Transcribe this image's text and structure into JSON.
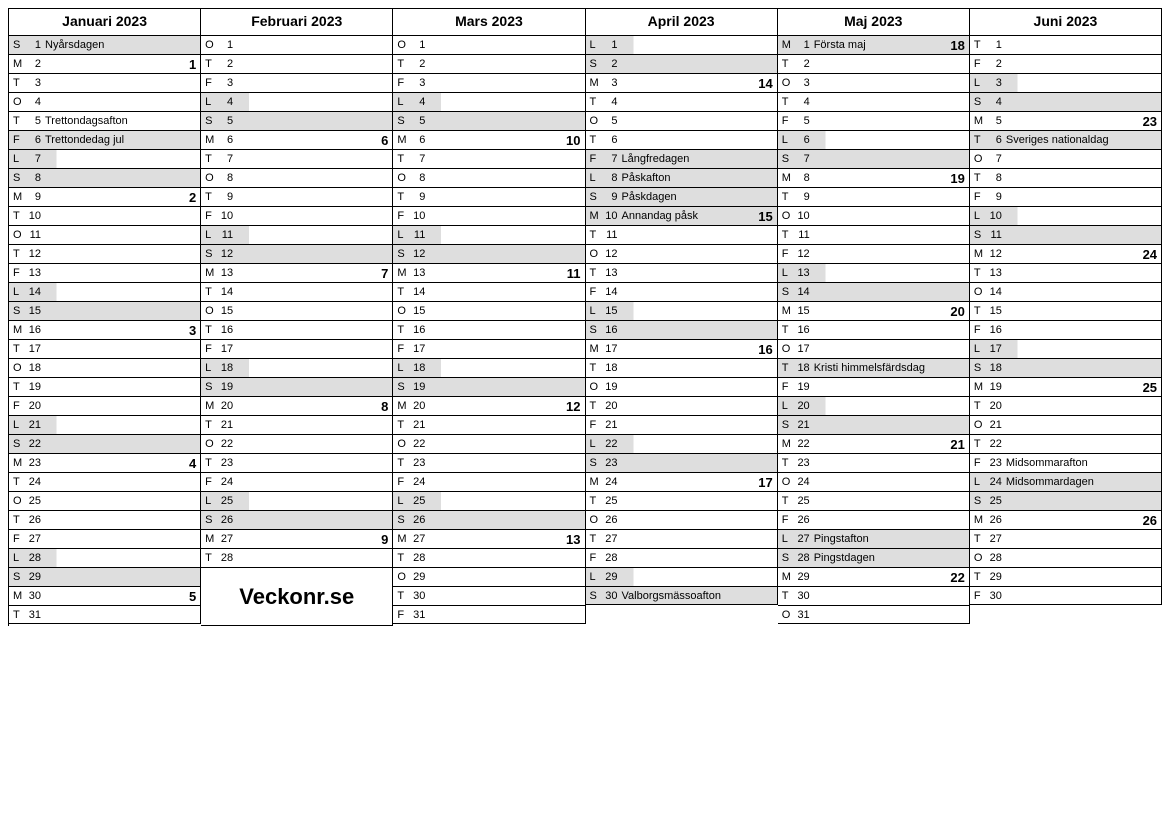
{
  "branding": "Veckonr.se",
  "months": [
    {
      "name": "Januari 2023",
      "days": [
        {
          "wd": "S",
          "n": 1,
          "label": "Nyårsdagen",
          "shade": "full"
        },
        {
          "wd": "M",
          "n": 2,
          "week": 1
        },
        {
          "wd": "T",
          "n": 3
        },
        {
          "wd": "O",
          "n": 4
        },
        {
          "wd": "T",
          "n": 5,
          "label": "Trettondagsafton"
        },
        {
          "wd": "F",
          "n": 6,
          "label": "Trettondedag jul",
          "shade": "full"
        },
        {
          "wd": "L",
          "n": 7,
          "shade": "partial"
        },
        {
          "wd": "S",
          "n": 8,
          "shade": "full"
        },
        {
          "wd": "M",
          "n": 9,
          "week": 2
        },
        {
          "wd": "T",
          "n": 10
        },
        {
          "wd": "O",
          "n": 11
        },
        {
          "wd": "T",
          "n": 12
        },
        {
          "wd": "F",
          "n": 13
        },
        {
          "wd": "L",
          "n": 14,
          "shade": "partial"
        },
        {
          "wd": "S",
          "n": 15,
          "shade": "full"
        },
        {
          "wd": "M",
          "n": 16,
          "week": 3
        },
        {
          "wd": "T",
          "n": 17
        },
        {
          "wd": "O",
          "n": 18
        },
        {
          "wd": "T",
          "n": 19
        },
        {
          "wd": "F",
          "n": 20
        },
        {
          "wd": "L",
          "n": 21,
          "shade": "partial"
        },
        {
          "wd": "S",
          "n": 22,
          "shade": "full"
        },
        {
          "wd": "M",
          "n": 23,
          "week": 4
        },
        {
          "wd": "T",
          "n": 24
        },
        {
          "wd": "O",
          "n": 25
        },
        {
          "wd": "T",
          "n": 26
        },
        {
          "wd": "F",
          "n": 27
        },
        {
          "wd": "L",
          "n": 28,
          "shade": "partial"
        },
        {
          "wd": "S",
          "n": 29,
          "shade": "full"
        },
        {
          "wd": "M",
          "n": 30,
          "week": 5
        },
        {
          "wd": "T",
          "n": 31
        }
      ]
    },
    {
      "name": "Februari 2023",
      "branding_after": true,
      "days": [
        {
          "wd": "O",
          "n": 1
        },
        {
          "wd": "T",
          "n": 2
        },
        {
          "wd": "F",
          "n": 3
        },
        {
          "wd": "L",
          "n": 4,
          "shade": "partial"
        },
        {
          "wd": "S",
          "n": 5,
          "shade": "full"
        },
        {
          "wd": "M",
          "n": 6,
          "week": 6
        },
        {
          "wd": "T",
          "n": 7
        },
        {
          "wd": "O",
          "n": 8
        },
        {
          "wd": "T",
          "n": 9
        },
        {
          "wd": "F",
          "n": 10
        },
        {
          "wd": "L",
          "n": 11,
          "shade": "partial"
        },
        {
          "wd": "S",
          "n": 12,
          "shade": "full"
        },
        {
          "wd": "M",
          "n": 13,
          "week": 7
        },
        {
          "wd": "T",
          "n": 14
        },
        {
          "wd": "O",
          "n": 15
        },
        {
          "wd": "T",
          "n": 16
        },
        {
          "wd": "F",
          "n": 17
        },
        {
          "wd": "L",
          "n": 18,
          "shade": "partial"
        },
        {
          "wd": "S",
          "n": 19,
          "shade": "full"
        },
        {
          "wd": "M",
          "n": 20,
          "week": 8
        },
        {
          "wd": "T",
          "n": 21
        },
        {
          "wd": "O",
          "n": 22
        },
        {
          "wd": "T",
          "n": 23
        },
        {
          "wd": "F",
          "n": 24
        },
        {
          "wd": "L",
          "n": 25,
          "shade": "partial"
        },
        {
          "wd": "S",
          "n": 26,
          "shade": "full"
        },
        {
          "wd": "M",
          "n": 27,
          "week": 9
        },
        {
          "wd": "T",
          "n": 28
        }
      ]
    },
    {
      "name": "Mars 2023",
      "days": [
        {
          "wd": "O",
          "n": 1
        },
        {
          "wd": "T",
          "n": 2
        },
        {
          "wd": "F",
          "n": 3
        },
        {
          "wd": "L",
          "n": 4,
          "shade": "partial"
        },
        {
          "wd": "S",
          "n": 5,
          "shade": "full"
        },
        {
          "wd": "M",
          "n": 6,
          "week": 10
        },
        {
          "wd": "T",
          "n": 7
        },
        {
          "wd": "O",
          "n": 8
        },
        {
          "wd": "T",
          "n": 9
        },
        {
          "wd": "F",
          "n": 10
        },
        {
          "wd": "L",
          "n": 11,
          "shade": "partial"
        },
        {
          "wd": "S",
          "n": 12,
          "shade": "full"
        },
        {
          "wd": "M",
          "n": 13,
          "week": 11
        },
        {
          "wd": "T",
          "n": 14
        },
        {
          "wd": "O",
          "n": 15
        },
        {
          "wd": "T",
          "n": 16
        },
        {
          "wd": "F",
          "n": 17
        },
        {
          "wd": "L",
          "n": 18,
          "shade": "partial"
        },
        {
          "wd": "S",
          "n": 19,
          "shade": "full"
        },
        {
          "wd": "M",
          "n": 20,
          "week": 12
        },
        {
          "wd": "T",
          "n": 21
        },
        {
          "wd": "O",
          "n": 22
        },
        {
          "wd": "T",
          "n": 23
        },
        {
          "wd": "F",
          "n": 24
        },
        {
          "wd": "L",
          "n": 25,
          "shade": "partial"
        },
        {
          "wd": "S",
          "n": 26,
          "shade": "full"
        },
        {
          "wd": "M",
          "n": 27,
          "week": 13
        },
        {
          "wd": "T",
          "n": 28
        },
        {
          "wd": "O",
          "n": 29
        },
        {
          "wd": "T",
          "n": 30
        },
        {
          "wd": "F",
          "n": 31
        }
      ]
    },
    {
      "name": "April 2023",
      "days": [
        {
          "wd": "L",
          "n": 1,
          "shade": "partial"
        },
        {
          "wd": "S",
          "n": 2,
          "shade": "full"
        },
        {
          "wd": "M",
          "n": 3,
          "week": 14
        },
        {
          "wd": "T",
          "n": 4
        },
        {
          "wd": "O",
          "n": 5
        },
        {
          "wd": "T",
          "n": 6
        },
        {
          "wd": "F",
          "n": 7,
          "label": "Långfredagen",
          "shade": "full"
        },
        {
          "wd": "L",
          "n": 8,
          "label": "Påskafton",
          "shade": "full"
        },
        {
          "wd": "S",
          "n": 9,
          "label": "Påskdagen",
          "shade": "full"
        },
        {
          "wd": "M",
          "n": 10,
          "label": "Annandag påsk",
          "week": 15,
          "shade": "full"
        },
        {
          "wd": "T",
          "n": 11
        },
        {
          "wd": "O",
          "n": 12
        },
        {
          "wd": "T",
          "n": 13
        },
        {
          "wd": "F",
          "n": 14
        },
        {
          "wd": "L",
          "n": 15,
          "shade": "partial"
        },
        {
          "wd": "S",
          "n": 16,
          "shade": "full"
        },
        {
          "wd": "M",
          "n": 17,
          "week": 16
        },
        {
          "wd": "T",
          "n": 18
        },
        {
          "wd": "O",
          "n": 19
        },
        {
          "wd": "T",
          "n": 20
        },
        {
          "wd": "F",
          "n": 21
        },
        {
          "wd": "L",
          "n": 22,
          "shade": "partial"
        },
        {
          "wd": "S",
          "n": 23,
          "shade": "full"
        },
        {
          "wd": "M",
          "n": 24,
          "week": 17
        },
        {
          "wd": "T",
          "n": 25
        },
        {
          "wd": "O",
          "n": 26
        },
        {
          "wd": "T",
          "n": 27
        },
        {
          "wd": "F",
          "n": 28
        },
        {
          "wd": "L",
          "n": 29,
          "shade": "partial"
        },
        {
          "wd": "S",
          "n": 30,
          "label": "Valborgsmässoafton",
          "shade": "full"
        }
      ]
    },
    {
      "name": "Maj 2023",
      "days": [
        {
          "wd": "M",
          "n": 1,
          "label": "Första maj",
          "week": 18,
          "shade": "full"
        },
        {
          "wd": "T",
          "n": 2
        },
        {
          "wd": "O",
          "n": 3
        },
        {
          "wd": "T",
          "n": 4
        },
        {
          "wd": "F",
          "n": 5
        },
        {
          "wd": "L",
          "n": 6,
          "shade": "partial"
        },
        {
          "wd": "S",
          "n": 7,
          "shade": "full"
        },
        {
          "wd": "M",
          "n": 8,
          "week": 19
        },
        {
          "wd": "T",
          "n": 9
        },
        {
          "wd": "O",
          "n": 10
        },
        {
          "wd": "T",
          "n": 11
        },
        {
          "wd": "F",
          "n": 12
        },
        {
          "wd": "L",
          "n": 13,
          "shade": "partial"
        },
        {
          "wd": "S",
          "n": 14,
          "shade": "full"
        },
        {
          "wd": "M",
          "n": 15,
          "week": 20
        },
        {
          "wd": "T",
          "n": 16
        },
        {
          "wd": "O",
          "n": 17
        },
        {
          "wd": "T",
          "n": 18,
          "label": "Kristi himmelsfärdsdag",
          "shade": "full"
        },
        {
          "wd": "F",
          "n": 19
        },
        {
          "wd": "L",
          "n": 20,
          "shade": "partial"
        },
        {
          "wd": "S",
          "n": 21,
          "shade": "full"
        },
        {
          "wd": "M",
          "n": 22,
          "week": 21
        },
        {
          "wd": "T",
          "n": 23
        },
        {
          "wd": "O",
          "n": 24
        },
        {
          "wd": "T",
          "n": 25
        },
        {
          "wd": "F",
          "n": 26
        },
        {
          "wd": "L",
          "n": 27,
          "label": "Pingstafton",
          "shade": "full"
        },
        {
          "wd": "S",
          "n": 28,
          "label": "Pingstdagen",
          "shade": "full"
        },
        {
          "wd": "M",
          "n": 29,
          "week": 22
        },
        {
          "wd": "T",
          "n": 30
        },
        {
          "wd": "O",
          "n": 31
        }
      ]
    },
    {
      "name": "Juni 2023",
      "days": [
        {
          "wd": "T",
          "n": 1
        },
        {
          "wd": "F",
          "n": 2
        },
        {
          "wd": "L",
          "n": 3,
          "shade": "partial"
        },
        {
          "wd": "S",
          "n": 4,
          "shade": "full"
        },
        {
          "wd": "M",
          "n": 5,
          "week": 23
        },
        {
          "wd": "T",
          "n": 6,
          "label": "Sveriges nationaldag",
          "shade": "full"
        },
        {
          "wd": "O",
          "n": 7
        },
        {
          "wd": "T",
          "n": 8
        },
        {
          "wd": "F",
          "n": 9
        },
        {
          "wd": "L",
          "n": 10,
          "shade": "partial"
        },
        {
          "wd": "S",
          "n": 11,
          "shade": "full"
        },
        {
          "wd": "M",
          "n": 12,
          "week": 24
        },
        {
          "wd": "T",
          "n": 13
        },
        {
          "wd": "O",
          "n": 14
        },
        {
          "wd": "T",
          "n": 15
        },
        {
          "wd": "F",
          "n": 16
        },
        {
          "wd": "L",
          "n": 17,
          "shade": "partial"
        },
        {
          "wd": "S",
          "n": 18,
          "shade": "full"
        },
        {
          "wd": "M",
          "n": 19,
          "week": 25
        },
        {
          "wd": "T",
          "n": 20
        },
        {
          "wd": "O",
          "n": 21
        },
        {
          "wd": "T",
          "n": 22
        },
        {
          "wd": "F",
          "n": 23,
          "label": "Midsommarafton"
        },
        {
          "wd": "L",
          "n": 24,
          "label": "Midsommardagen",
          "shade": "full"
        },
        {
          "wd": "S",
          "n": 25,
          "shade": "full"
        },
        {
          "wd": "M",
          "n": 26,
          "week": 26
        },
        {
          "wd": "T",
          "n": 27
        },
        {
          "wd": "O",
          "n": 28
        },
        {
          "wd": "T",
          "n": 29
        },
        {
          "wd": "F",
          "n": 30
        }
      ]
    }
  ]
}
